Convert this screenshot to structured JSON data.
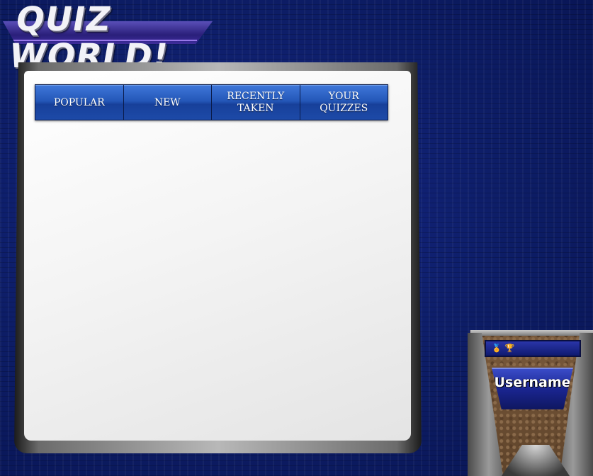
{
  "app": {
    "logo_text": "QUIZ WORLD!"
  },
  "tabs": [
    {
      "label": "POPULAR"
    },
    {
      "label": "NEW"
    },
    {
      "label": "RECENTLY\nTAKEN"
    },
    {
      "label": "YOUR\nQUIZZES"
    }
  ],
  "user_card": {
    "username": "Username",
    "icons": [
      "medal-icon",
      "trophy-icon"
    ]
  },
  "colors": {
    "background": "#0d1d66",
    "tab_blue": "#2457b8",
    "panel": "#f4f4f4",
    "name_plate": "#1a2590",
    "card_wood": "#6a4c32"
  }
}
